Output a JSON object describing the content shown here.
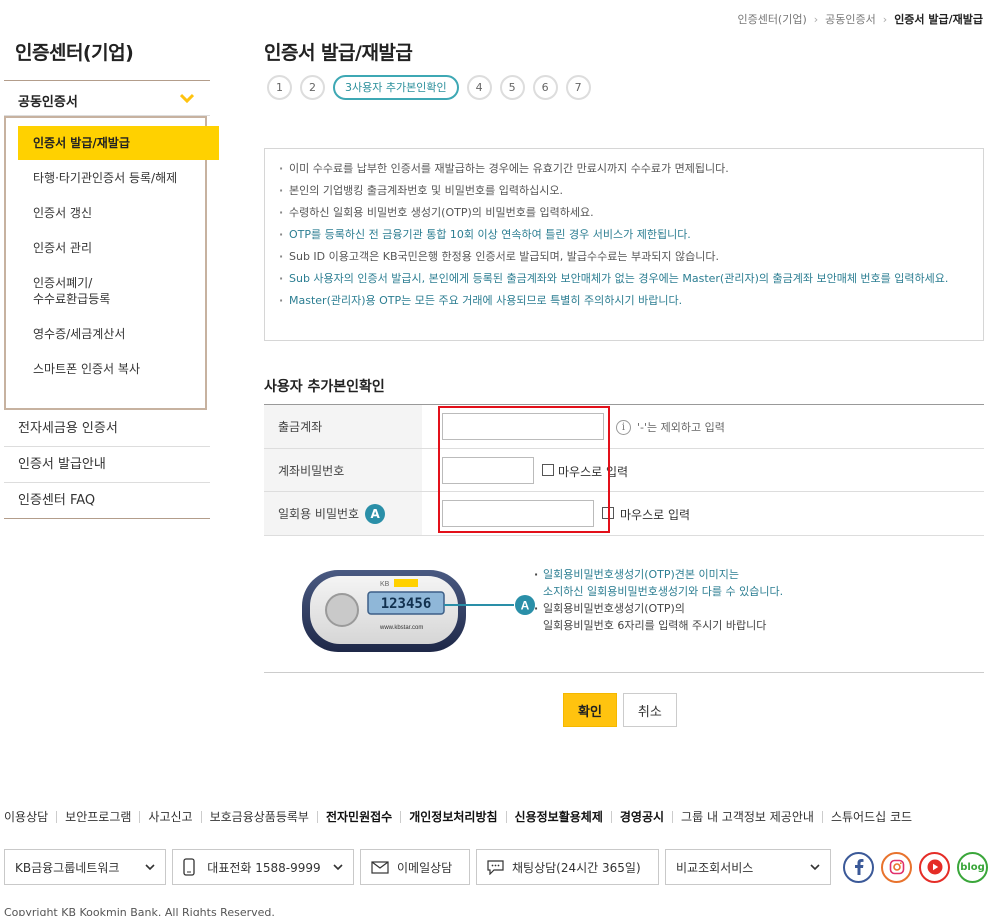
{
  "breadcrumb": {
    "items": [
      "인증센터(기업)",
      "공동인증서",
      "인증서 발급/재발급"
    ]
  },
  "sidebar": {
    "title": "인증센터(기업)",
    "section": "공동인증서",
    "sub_items": [
      "인증서 발급/재발급",
      "타행·타기관인증서 등록/해제",
      "인증서 갱신",
      "인증서 관리",
      "인증서폐기/\n수수료환급등록",
      "영수증/세금계산서",
      "스마트폰 인증서 복사"
    ],
    "links": [
      "전자세금용 인증서",
      "인증서 발급안내",
      "인증센터 FAQ"
    ]
  },
  "page": {
    "title": "인증서 발급/재발급",
    "steps": [
      "1",
      "2",
      "3사용자 추가본인확인",
      "4",
      "5",
      "6",
      "7"
    ],
    "active_step_index": 2
  },
  "notice": {
    "items": [
      {
        "text": "이미 수수료를 납부한 인증서를 재발급하는 경우에는 유효기간 만료시까지 수수료가 면제됩니다.",
        "teal": false
      },
      {
        "text": "본인의 기업뱅킹 출금계좌번호 및 비밀번호를 입력하십시오.",
        "teal": false
      },
      {
        "text": "수령하신 일회용 비밀번호 생성기(OTP)의 비밀번호를 입력하세요.",
        "teal": false
      },
      {
        "text": "OTP를 등록하신 전 금융기관 통합 10회 이상 연속하여 틀린 경우 서비스가 제한됩니다.",
        "teal": true
      },
      {
        "text": "Sub ID 이용고객은 KB국민은행 한정용 인증서로 발급되며, 발급수수료는 부과되지 않습니다.",
        "teal": false
      },
      {
        "text": "Sub 사용자의 인증서 발급시, 본인에게 등록된 출금계좌와 보안매체가 없는 경우에는 Master(관리자)의 출금계좌 보안매체 번호를 입력하세요.",
        "teal": true
      },
      {
        "text": "Master(관리자)용 OTP는 모든 주요 거래에 사용되므로 특별히 주의하시기 바랍니다.",
        "teal": true
      }
    ]
  },
  "form": {
    "title": "사용자 추가본인확인",
    "account_label": "출금계좌",
    "account_value": "",
    "account_hint": "'-'는 제외하고 입력",
    "password_label": "계좌비밀번호",
    "password_value": "",
    "mouse_input_label": "마우스로 입력",
    "otp_label": "일회용 비밀번호",
    "otp_badge": "A",
    "otp_value": ""
  },
  "otp_info": {
    "device_brand": "KB",
    "device_number": "123456",
    "device_url": "www.kbstar.com",
    "badge": "A",
    "notes": [
      {
        "lines": [
          "일회용비밀번호생성기(OTP)견본 이미지는",
          "소지하신 일회용비밀번호생성기와 다를 수 있습니다."
        ],
        "teal": true
      },
      {
        "lines": [
          "일회용비밀번호생성기(OTP)의",
          "일회용비밀번호 6자리를 입력해 주시기 바랍니다"
        ],
        "teal": false
      }
    ]
  },
  "buttons": {
    "confirm": "확인",
    "cancel": "취소"
  },
  "footer": {
    "links": [
      {
        "text": "이용상담",
        "bold": false
      },
      {
        "text": "보안프로그램",
        "bold": false
      },
      {
        "text": "사고신고",
        "bold": false
      },
      {
        "text": "보호금융상품등록부",
        "bold": false
      },
      {
        "text": "전자민원접수",
        "bold": true
      },
      {
        "text": "개인정보처리방침",
        "bold": true
      },
      {
        "text": "신용정보활용체제",
        "bold": true
      },
      {
        "text": "경영공시",
        "bold": true
      },
      {
        "text": "그룹 내 고객정보 제공안내",
        "bold": false
      },
      {
        "text": "스튜어드십 코드",
        "bold": false
      }
    ],
    "network": "KB금융그룹네트워크",
    "phone": "대표전화 1588-9999",
    "email": "이메일상담",
    "chat": "채팅상담(24시간 365일)",
    "compare": "비교조회서비스",
    "social": [
      "facebook-icon",
      "instagram-icon",
      "youtube-icon",
      "blog-icon"
    ],
    "blog_label": "blog",
    "copyright": "Copyright KB Kookmin Bank. All Rights Reserved."
  },
  "colors": {
    "accent_yellow": "#ffd100",
    "teal": "#2c7e92",
    "highlight_red": "#e3101a"
  }
}
